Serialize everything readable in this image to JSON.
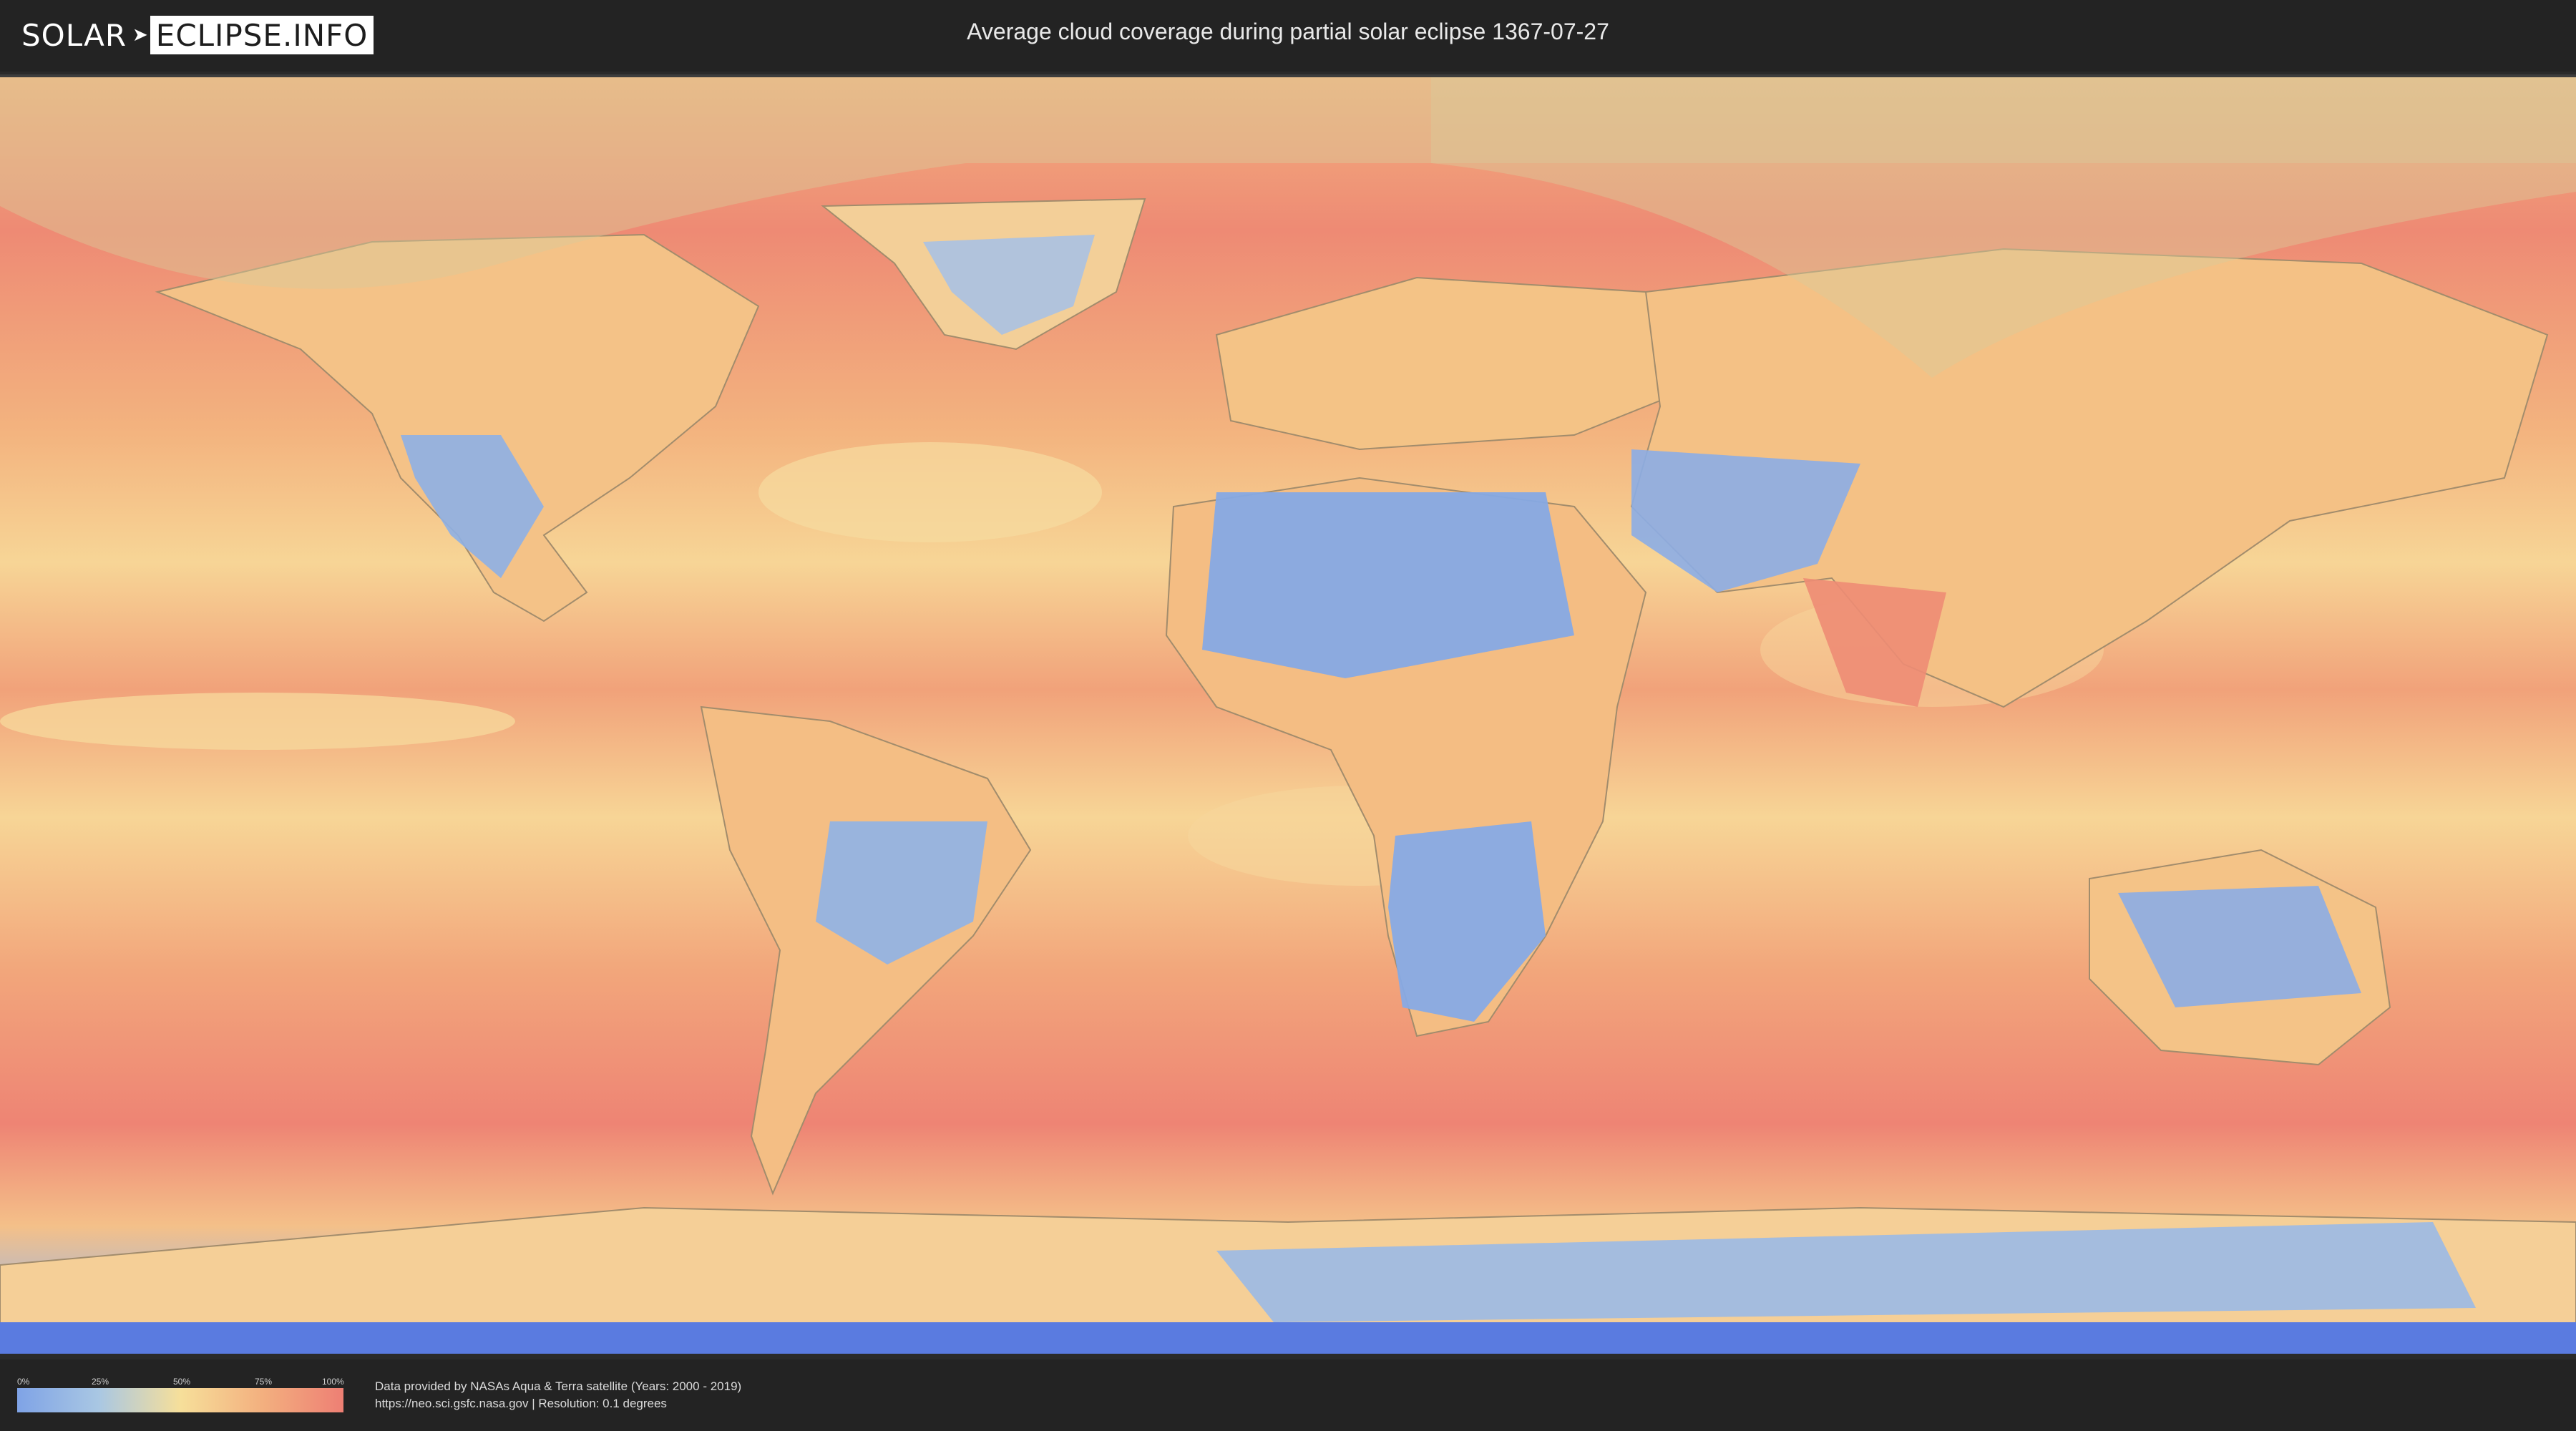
{
  "header": {
    "logo_left": "SOLAR",
    "logo_right": "ECLIPSE.INFO",
    "title": "Average cloud coverage during partial solar eclipse 1367-07-27"
  },
  "map": {
    "ocean_color": "#ef8f76",
    "land_color": "#f4c185",
    "desert_color": "#86a9e4",
    "eclipse_overlay_color": "#d9c99a"
  },
  "legend": {
    "ticks": [
      "0%",
      "25%",
      "50%",
      "75%",
      "100%"
    ],
    "colors": [
      "#7fa3e6",
      "#a9c7e3",
      "#f6df9a",
      "#f3b07f",
      "#ee7f74"
    ]
  },
  "credits": {
    "line1": "Data provided by NASAs Aqua & Terra satellite (Years: 2000 - 2019)",
    "line2": "https://neo.sci.gsfc.nasa.gov | Resolution: 0.1 degrees"
  }
}
